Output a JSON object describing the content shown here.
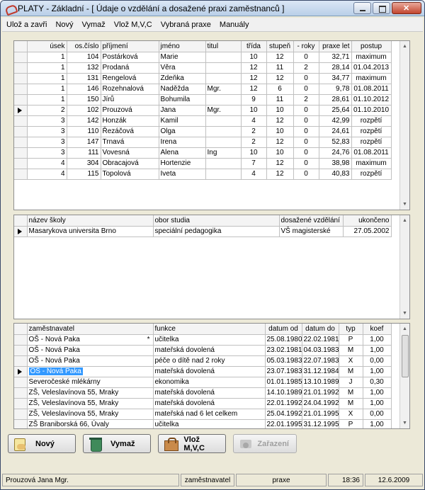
{
  "window": {
    "title": "PLATY  - Základní - [ Údaje o vzdělání a dosažené praxi zaměstnanců ]"
  },
  "menu": [
    "Ulož a zavři",
    "Nový",
    "Vymaž",
    "Vlož M,V,C",
    "Vybraná praxe",
    "Manuály"
  ],
  "employees": {
    "headers": [
      "úsek",
      "os.číslo",
      "příjmení",
      "jméno",
      "titul",
      "třída",
      "stupeň",
      "- roky",
      "praxe let",
      "postup"
    ],
    "rows": [
      [
        "1",
        "104",
        "Postárková",
        "Marie",
        "",
        "10",
        "12",
        "0",
        "32,71",
        "maximum"
      ],
      [
        "1",
        "132",
        "Prodaná",
        "Věra",
        "",
        "12",
        "11",
        "2",
        "28,14",
        "01.04.2013"
      ],
      [
        "1",
        "131",
        "Rengelová",
        "Zdeňka",
        "",
        "12",
        "12",
        "0",
        "34,77",
        "maximum"
      ],
      [
        "1",
        "146",
        "Rozehnalová",
        "Naděžda",
        "Mgr.",
        "12",
        "6",
        "0",
        "9,78",
        "01.08.2011"
      ],
      [
        "1",
        "150",
        "Jírů",
        "Bohumila",
        "",
        "9",
        "11",
        "2",
        "28,61",
        "01.10.2012"
      ],
      [
        "2",
        "102",
        "Prouzová",
        "Jana",
        "Mgr.",
        "10",
        "10",
        "0",
        "25,64",
        "01.10.2010"
      ],
      [
        "3",
        "142",
        "Honzák",
        "Kamil",
        "",
        "4",
        "12",
        "0",
        "42,99",
        "rozpětí"
      ],
      [
        "3",
        "110",
        "Řezáčová",
        "Olga",
        "",
        "2",
        "10",
        "0",
        "24,61",
        "rozpětí"
      ],
      [
        "3",
        "147",
        "Trnavá",
        "Irena",
        "",
        "2",
        "12",
        "0",
        "52,83",
        "rozpětí"
      ],
      [
        "3",
        "111",
        "Vovesná",
        "Alena",
        "Ing",
        "10",
        "10",
        "0",
        "24,76",
        "01.08.2011"
      ],
      [
        "4",
        "304",
        "Obracajová",
        "Hortenzie",
        "",
        "7",
        "12",
        "0",
        "38,98",
        "maximum"
      ],
      [
        "4",
        "115",
        "Topolová",
        "Iveta",
        "",
        "4",
        "12",
        "0",
        "40,83",
        "rozpětí"
      ]
    ],
    "current_row": 5
  },
  "education": {
    "headers": [
      "název školy",
      "obor studia",
      "dosažené vzdělání",
      "ukončeno"
    ],
    "rows": [
      [
        "Masarykova universita Brno",
        "speciální pedagogika",
        "VŠ magisterské",
        "27.05.2002"
      ]
    ]
  },
  "practice": {
    "headers": [
      "zaměstnavatel",
      "funkce",
      "datum od",
      "datum do",
      "typ",
      "koef"
    ],
    "rows": [
      [
        "OŠ - Nová Paka",
        "učitelka",
        "25.08.1980",
        "22.02.1981",
        "P",
        "1,00",
        "*"
      ],
      [
        "OŠ - Nová Paka",
        "mateřská dovolená",
        "23.02.1981",
        "04.03.1983",
        "M",
        "1,00",
        ""
      ],
      [
        "OŠ - Nová Paka",
        "péče o dítě nad 2 roky",
        "05.03.1983",
        "22.07.1983",
        "X",
        "0,00",
        ""
      ],
      [
        "OŠ - Nová Paka",
        "mateřská dovolená",
        "23.07.1983",
        "31.12.1984",
        "M",
        "1,00",
        ""
      ],
      [
        "Severočeské mlékárny",
        "ekonomika",
        "01.01.1985",
        "13.10.1989",
        "J",
        "0,30",
        ""
      ],
      [
        "ZŠ, Veleslavínova 55, Mraky",
        "mateřská dovolená",
        "14.10.1989",
        "21.01.1992",
        "M",
        "1,00",
        ""
      ],
      [
        "ZŠ, Veleslavínova 55, Mraky",
        "mateřská dovolená",
        "22.01.1992",
        "24.04.1992",
        "M",
        "1,00",
        ""
      ],
      [
        "ZŠ, Veleslavínova 55, Mraky",
        "mateřská nad 6 let celkem",
        "25.04.1992",
        "21.01.1995",
        "X",
        "0,00",
        ""
      ],
      [
        "ZŠ Braniborská 66, Úvaly",
        "učitelka",
        "22.01.1995",
        "31.12.1995",
        "P",
        "1,00",
        ""
      ]
    ],
    "current_row": 3
  },
  "buttons": {
    "new": "Nový",
    "delete": "Vymaž",
    "insert": "Vlož M,V,C",
    "assign": "Zařazení"
  },
  "status": {
    "user": "Prouzová Jana Mgr.",
    "section1": "zaměstnavatel",
    "section2": "praxe",
    "time": "18:36",
    "date": "12.6.2009"
  }
}
